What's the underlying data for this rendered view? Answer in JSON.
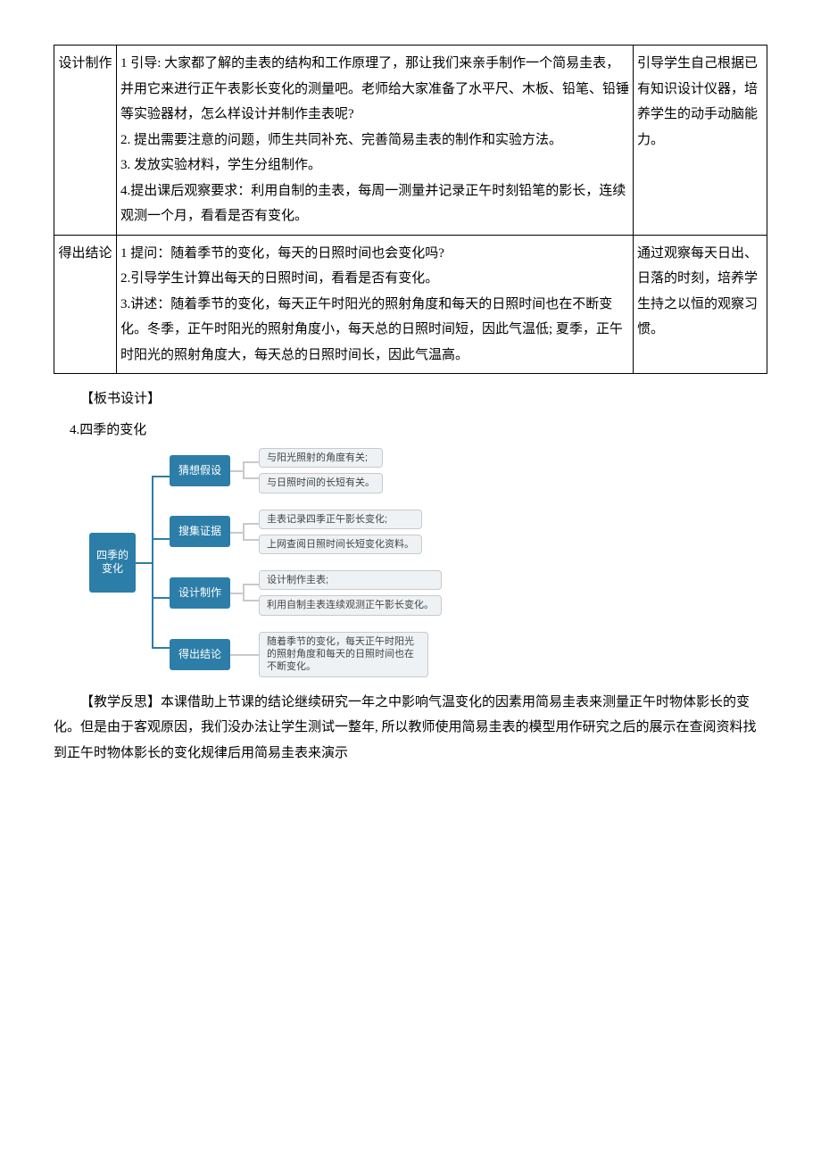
{
  "row1": {
    "label": "设计制作",
    "body": "1 引导: 大家都了解的圭表的结构和工作原理了，那让我们来亲手制作一个简易圭表，并用它来进行正午表影长变化的测量吧。老师给大家准备了水平尺、木板、铅笔、铅锤等实验器材，怎么样设计并制作圭表呢?\n2. 提出需要注意的问题，师生共同补充、完善简易圭表的制作和实验方法。\n3. 发放实验材料，学生分组制作。\n4.提出课后观察要求：利用自制的圭表，每周一测量并记录正午时刻铅笔的影长，连续观测一个月，看看是否有变化。",
    "note": "引导学生自己根据已有知识设计仪器，培养学生的动手动脑能力。"
  },
  "row2": {
    "label": "得出结论",
    "body": "1 提问：随着季节的变化，每天的日照时间也会变化吗?\n2.引导学生计算出每天的日照时间，看看是否有变化。\n3.讲述：随着季节的变化，每天正午时阳光的照射角度和每天的日照时间也在不断变化。冬季，正午时阳光的照射角度小，每天总的日照时间短，因此气温低; 夏季，正午时阳光的照射角度大，每天总的日照时间长，因此气温高。",
    "note": "通过观察每天日出、日落的时刻，培养学生持之以恒的观察习惯。"
  },
  "headingBoard": "【板书设计】",
  "headingLesson": "4.四季的变化",
  "chart_data": {
    "type": "tree",
    "root": "四季的\n变化",
    "branches": [
      {
        "name": "猜想假设",
        "leaves": [
          "与阳光照射的角度有关;",
          "与日照时间的长短有关。"
        ]
      },
      {
        "name": "搜集证据",
        "leaves": [
          "圭表记录四季正午影长变化;",
          "上网查阅日照时间长短变化资料。"
        ]
      },
      {
        "name": "设计制作",
        "leaves": [
          "设计制作圭表;",
          "利用自制圭表连续观测正午影长变化。"
        ]
      },
      {
        "name": "得出结论",
        "leaves": [
          "随着季节的变化，每天正午时阳光的照射角度和每天的日照时间也在不断变化。"
        ]
      }
    ]
  },
  "reflection": "【教学反思】本课借助上节课的结论继续研究一年之中影响气温变化的因素用简易圭表来测量正午时物体影长的变化。但是由于客观原因，我们没办法让学生测试一整年, 所以教师使用简易圭表的模型用作研究之后的展示在查阅资料找到正午时物体影长的变化规律后用简易圭表来演示"
}
